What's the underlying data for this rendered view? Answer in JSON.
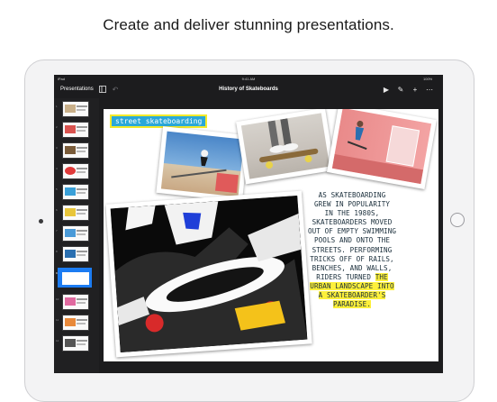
{
  "headline": "Create and deliver stunning presentations.",
  "status_bar": {
    "device": "iPad",
    "time": "9:41 AM",
    "battery": "100%"
  },
  "toolbar": {
    "presentations_label": "Presentations",
    "document_title": "History of Skateboards",
    "icons": [
      "sidebar-toggle-icon",
      "undo-icon",
      "play-icon",
      "brush-icon",
      "add-icon",
      "more-icon"
    ]
  },
  "slides": {
    "numbers": [
      "1",
      "2",
      "3",
      "4",
      "5",
      "6",
      "7",
      "8",
      "9",
      "10",
      "11",
      "12"
    ],
    "selected_index": 8
  },
  "slide": {
    "title": "street skateboarding",
    "body_lines": [
      "AS SKATEBOARDING",
      "GREW IN POPULARITY",
      "IN THE 1980S,",
      "SKATEBOARDERS MOVED",
      "OUT OF EMPTY SWIMMING",
      "POOLS AND ONTO THE",
      "STREETS. PERFORMING",
      "TRICKS OFF OF RAILS,",
      "BENCHES, AND WALLS,"
    ],
    "body_line_10_plain": "RIDERS TURNED ",
    "body_line_10_highlight": "THE",
    "body_highlight_lines": [
      "URBAN LANDSCAPE INTO",
      "A SKATEBOARDER'S",
      "PARADISE."
    ]
  },
  "colors": {
    "title_bg": "#2aa8d8",
    "title_outline": "#f3ea2a",
    "highlight": "#fdf03a",
    "selection": "#1c7cf2",
    "toolbar_bg": "#1c1c1e"
  }
}
